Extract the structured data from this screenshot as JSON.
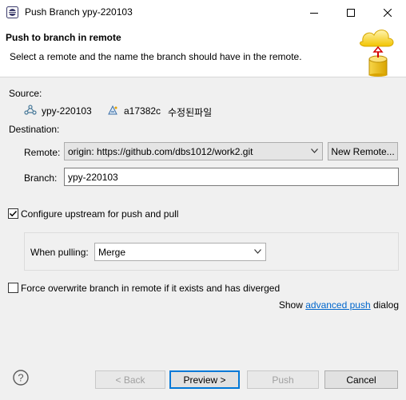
{
  "window": {
    "title": "Push Branch ypy-220103",
    "icon": "eclipse-icon",
    "controls": {
      "minimize": "—",
      "maximize": "☐",
      "close": "✕"
    }
  },
  "banner": {
    "title": "Push to branch in remote",
    "description": "Select a remote and the name the branch should have in the remote."
  },
  "source": {
    "label": "Source:",
    "branch": "ypy-220103",
    "commit_id": "a17382c",
    "commit_message": "수정된파일"
  },
  "destination": {
    "label": "Destination:",
    "remote_label": "Remote:",
    "remote_value": "origin: https://github.com/dbs1012/work2.git",
    "new_remote_button": "New Remote...",
    "branch_label": "Branch:",
    "branch_value": "ypy-220103"
  },
  "upstream": {
    "checkbox_label": "Configure upstream for push and pull",
    "checked": true,
    "when_pulling_label": "When pulling:",
    "when_pulling_value": "Merge"
  },
  "force": {
    "checkbox_label": "Force overwrite branch in remote if it exists and has diverged",
    "checked": false
  },
  "advanced": {
    "prefix": "Show",
    "link": "advanced push",
    "suffix": "dialog"
  },
  "footer": {
    "back": "< Back",
    "preview": "Preview >",
    "push": "Push",
    "cancel": "Cancel"
  },
  "colors": {
    "accent": "#0078d7",
    "link": "#0066cc"
  }
}
